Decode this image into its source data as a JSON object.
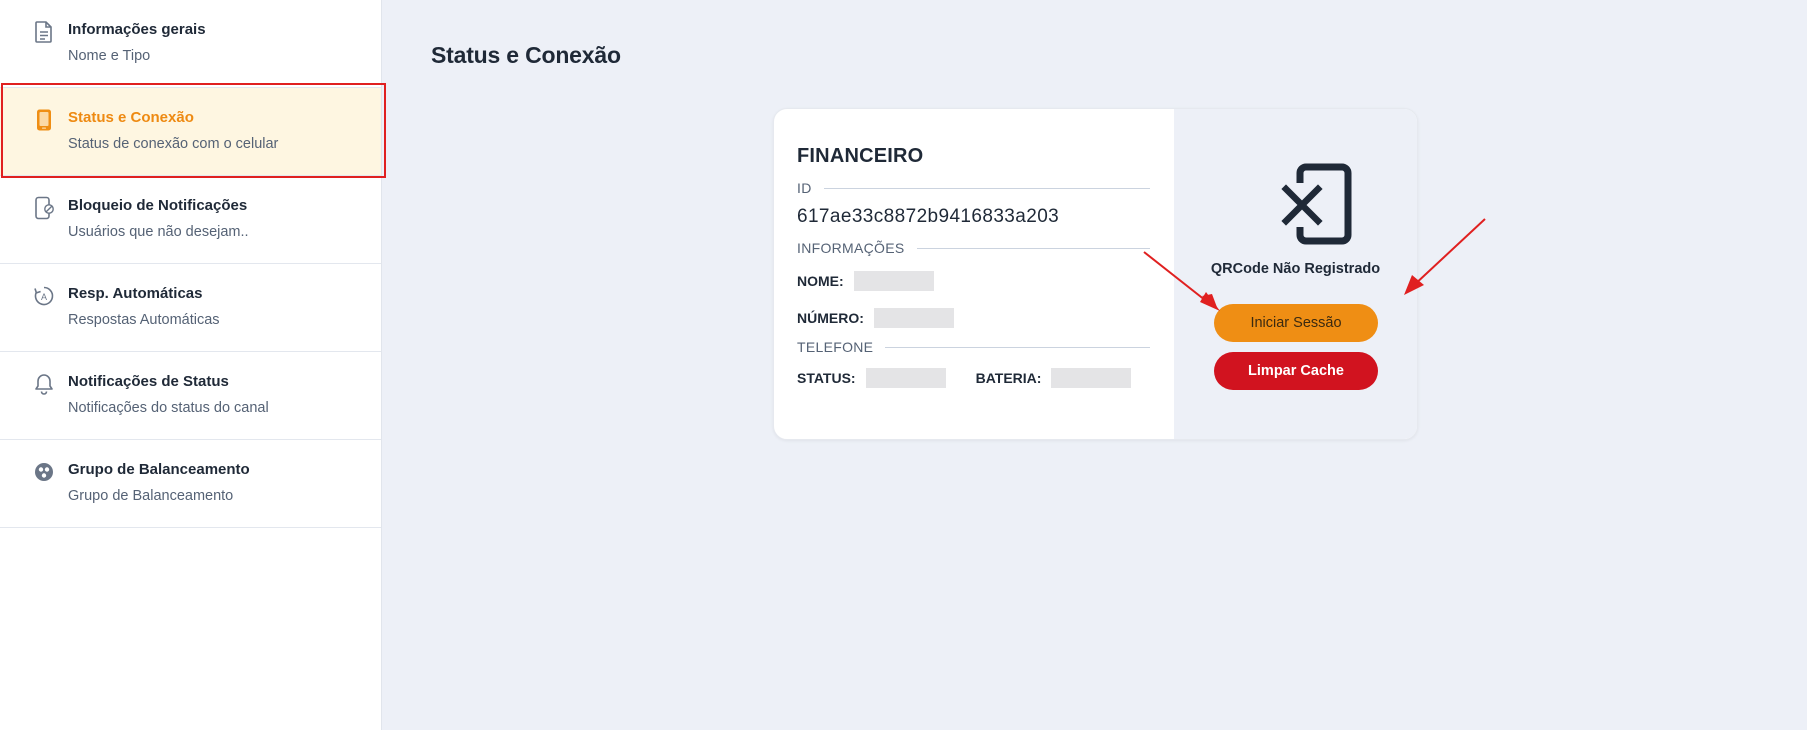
{
  "sidebar": {
    "items": [
      {
        "title": "Informações gerais",
        "subtitle": "Nome e Tipo",
        "icon": "document-icon"
      },
      {
        "title": "Status e Conexão",
        "subtitle": "Status de conexão com o celular",
        "icon": "phone-icon",
        "active": true
      },
      {
        "title": "Bloqueio de Notificações",
        "subtitle": "Usuários que não desejam..",
        "icon": "phone-block-icon"
      },
      {
        "title": "Resp. Automáticas",
        "subtitle": "Respostas Automáticas",
        "icon": "auto-reply-icon"
      },
      {
        "title": "Notificações de Status",
        "subtitle": "Notificações do status do canal",
        "icon": "bell-icon"
      },
      {
        "title": "Grupo de Balanceamento",
        "subtitle": "Grupo de Balanceamento",
        "icon": "balance-group-icon"
      }
    ]
  },
  "main": {
    "title": "Status e Conexão"
  },
  "card": {
    "channel_name": "FINANCEIRO",
    "id_label": "ID",
    "id_value": "617ae33c8872b9416833a203",
    "info_label": "INFORMAÇÕES",
    "name_label": "NOME:",
    "number_label": "NÚMERO:",
    "phone_label": "TELEFONE",
    "status_label": "STATUS:",
    "battery_label": "BATERIA:",
    "qr_status": "QRCode Não Registrado",
    "start_button": "Iniciar Sessão",
    "clear_button": "Limpar Cache"
  },
  "colors": {
    "accent": "#ef8e14",
    "danger": "#d1131f",
    "active_bg": "#fef6e1",
    "annotation": "#e02020"
  }
}
